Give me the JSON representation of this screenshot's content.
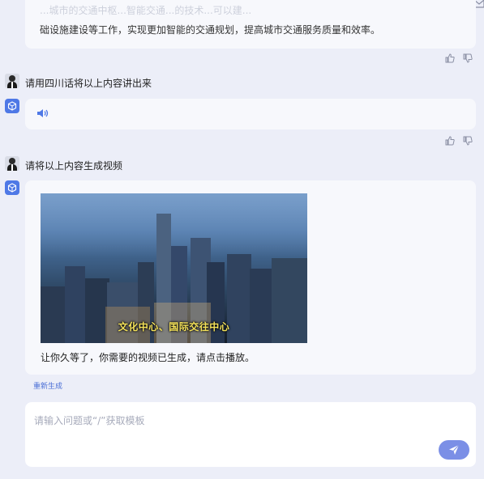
{
  "messages": {
    "ai1": {
      "faded_text": "...城市的交通中枢...智能交通...的技术...可以建...",
      "text": "础设施建设等工作，实现更加智能的交通规划，提高城市交通服务质量和效率。"
    },
    "user1": {
      "text": "请用四川话将以上内容讲出来"
    },
    "user2": {
      "text": "请将以上内容生成视频"
    },
    "ai3": {
      "video_caption": "文化中心、国际交往中心",
      "text": "让你久等了，你需要的视频已生成，请点击播放。"
    }
  },
  "regenerate_label": "重新生成",
  "input": {
    "placeholder": "请输入问题或“/”获取模板"
  },
  "icons": {
    "thumbs_up": "thumbs-up-icon",
    "thumbs_down": "thumbs-down-icon",
    "speaker": "speaker-icon",
    "send": "send-icon",
    "ai_avatar": "ai-cube-icon",
    "mail": "mail-icon"
  },
  "colors": {
    "accent": "#4e78e6",
    "send_button": "#7b8fe6",
    "caption": "#f4e25a",
    "background": "#eceef8"
  }
}
